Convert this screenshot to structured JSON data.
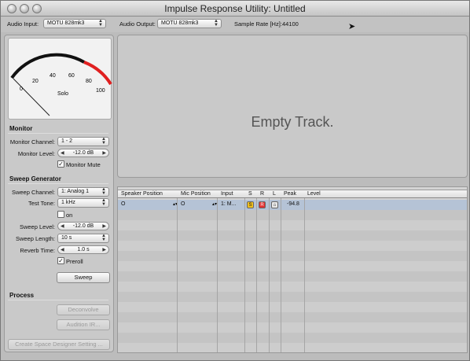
{
  "window": {
    "title": "Impulse Response Utility: Untitled"
  },
  "io": {
    "input_label": "Audio Input:",
    "input_value": "MOTU 828mk3",
    "output_label": "Audio Output:",
    "output_value": "MOTU 828mk3",
    "sample_rate_label": "Sample Rate [Hz]:",
    "sample_rate_value": "44100"
  },
  "meter": {
    "ticks": [
      "0",
      "20",
      "40",
      "60",
      "80",
      "100"
    ],
    "label": "Solo"
  },
  "monitor": {
    "section": "Monitor",
    "channel_label": "Monitor Channel:",
    "channel_value": "1 - 2",
    "level_label": "Monitor  Level:",
    "level_value": "-12.0 dB",
    "mute_label": "Monitor Mute",
    "mute_checked": true
  },
  "sweep": {
    "section": "Sweep Generator",
    "channel_label": "Sweep Channel:",
    "channel_value": "1: Analog 1",
    "tone_label": "Test Tone:",
    "tone_value": "1 kHz",
    "on_label": "on",
    "level_label": "Sweep Level:",
    "level_value": "-12.0 dB",
    "length_label": "Sweep Length:",
    "length_value": "10 s",
    "reverb_label": "Reverb Time:",
    "reverb_value": "1.0 s",
    "preroll_label": "Preroll",
    "preroll_checked": true,
    "sweep_button": "Sweep"
  },
  "process": {
    "section": "Process",
    "deconvolve": "Deconvolve",
    "audition": "Audition IR...",
    "create": "Create Space Designer Setting ..."
  },
  "track": {
    "empty_text": "Empty Track."
  },
  "table": {
    "headers": [
      "Speaker Position",
      "Mic Position",
      "Input",
      "S",
      "R",
      "L",
      "Peak",
      "Level"
    ],
    "row": {
      "speaker": "O",
      "mic": "O",
      "input": "1: M...",
      "s": "S",
      "r": "R",
      "l": "⌂",
      "peak": "-94.8"
    }
  },
  "colors": {
    "solo": "#f0c020",
    "record": "#e03030",
    "meter_red": "#e02020",
    "selected_row": "#b5c3d6"
  }
}
